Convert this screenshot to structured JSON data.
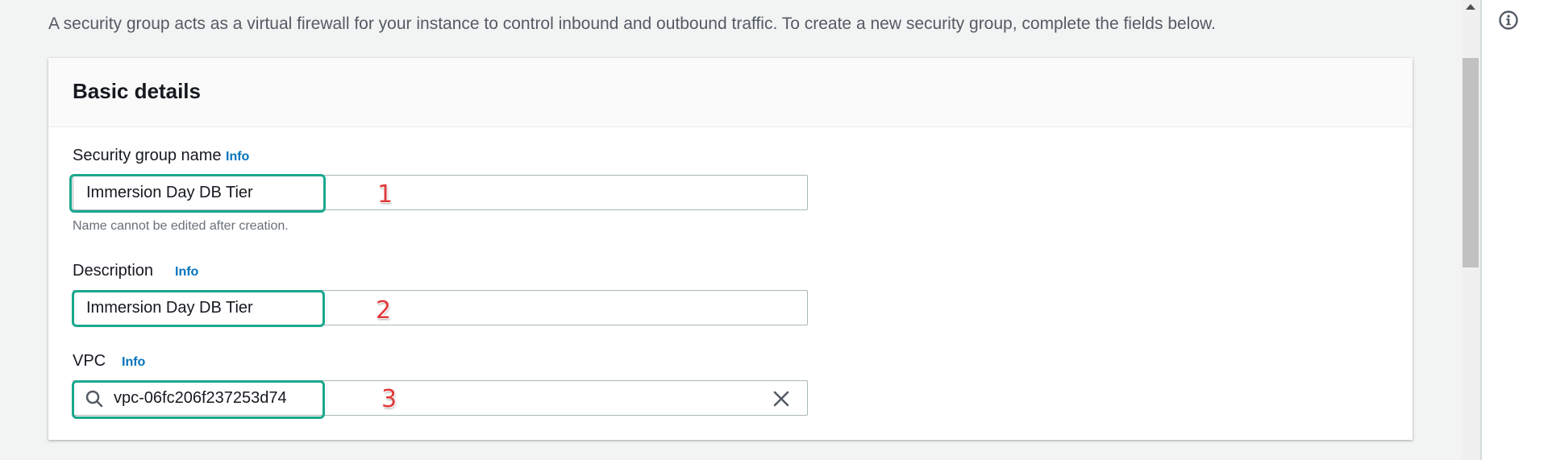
{
  "intro_text": "A security group acts as a virtual firewall for your instance to control inbound and outbound traffic. To create a new security group, complete the fields below.",
  "panel": {
    "title": "Basic details",
    "fields": {
      "name": {
        "label": "Security group name",
        "info": "Info",
        "value": "Immersion Day DB Tier",
        "hint": "Name cannot be edited after creation.",
        "step": "1"
      },
      "description": {
        "label": "Description",
        "info": "Info",
        "value": "Immersion Day DB Tier",
        "step": "2"
      },
      "vpc": {
        "label": "VPC",
        "info": "Info",
        "value": "vpc-06fc206f237253d74",
        "step": "3"
      }
    }
  },
  "colors": {
    "highlight": "#1aa88e",
    "link": "#0073bb",
    "step_number": "#e03a3a"
  },
  "icons": [
    "search-icon",
    "clear-icon",
    "info-circle-icon",
    "scroll-up-arrow-icon"
  ]
}
